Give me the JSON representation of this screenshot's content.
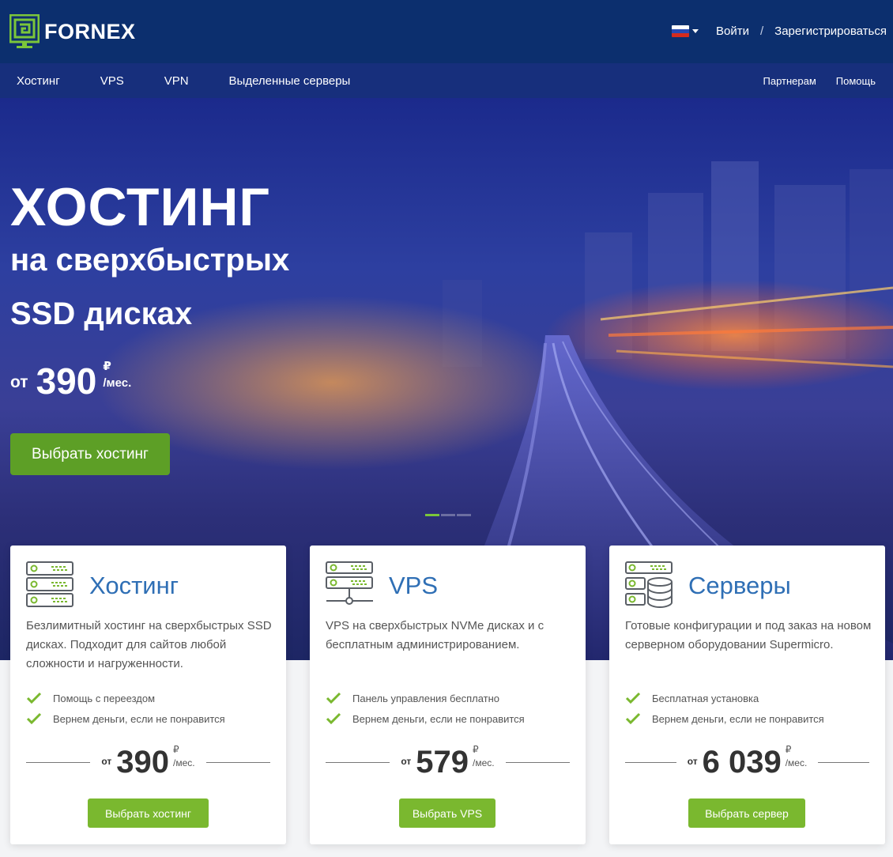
{
  "header": {
    "logo_text": "FORNEX",
    "language": "Russian",
    "login_label": "Войти",
    "separator": "/",
    "register_label": "Зарегистрироваться"
  },
  "nav": {
    "left": [
      "Хостинг",
      "VPS",
      "VPN",
      "Выделенные серверы"
    ],
    "right": [
      "Партнерам",
      "Помощь"
    ]
  },
  "hero": {
    "title": "ХОСТИНГ",
    "subtitle_line1": "на сверхбыстрых",
    "subtitle_line2": "SSD дисках",
    "price_prefix": "от",
    "price": "390",
    "currency": "₽",
    "period": "/мес.",
    "button_label": "Выбрать хостинг",
    "slides_count": 3,
    "active_slide": 1
  },
  "cards": [
    {
      "title": "Хостинг",
      "description": "Безлимитный хостинг на сверхбыстрых SSD дисках. Подходит для сайтов любой сложности и нагруженности.",
      "features": [
        "Помощь с переездом",
        "Вернем деньги, если не понравится"
      ],
      "price_prefix": "от",
      "price": "390",
      "currency": "₽",
      "period": "/мес.",
      "button_label": "Выбрать хостинг"
    },
    {
      "title": "VPS",
      "description": "VPS на сверхбыстрых NVMe дисках и с бесплатным администрированием.",
      "features": [
        "Панель управления бесплатно",
        "Вернем деньги, если не понравится"
      ],
      "price_prefix": "от",
      "price": "579",
      "currency": "₽",
      "period": "/мес.",
      "button_label": "Выбрать VPS"
    },
    {
      "title": "Серверы",
      "description": "Готовые конфигурации и под заказ на новом серверном оборудовании Supermicro.",
      "features": [
        "Бесплатная установка",
        "Вернем деньги, если не понравится"
      ],
      "price_prefix": "от",
      "price": "6 039",
      "currency": "₽",
      "period": "/мес.",
      "button_label": "Выбрать сервер"
    }
  ],
  "colors": {
    "header_bg": "#0c2f6e",
    "nav_bg": "#172f7c",
    "logo_green": "#7bc63a",
    "hero_button": "#5d9f26",
    "card_button": "#7ab82f",
    "card_title": "#2f6fb5",
    "check": "#7ab82f"
  }
}
